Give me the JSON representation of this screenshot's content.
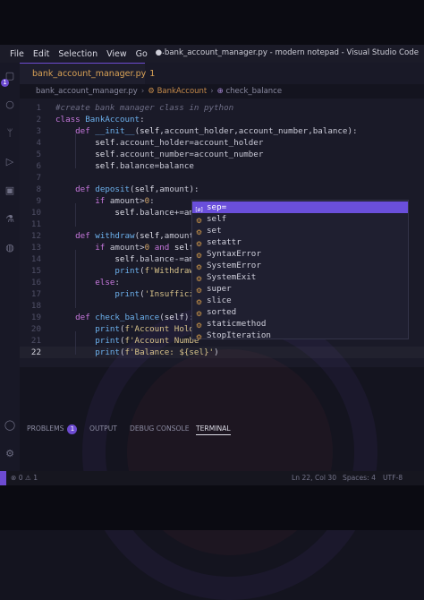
{
  "menu": [
    "File",
    "Edit",
    "Selection",
    "View",
    "Go",
    "···"
  ],
  "window_title": "● bank_account_manager.py - modern notepad - Visual Studio Code",
  "activity_badge": "1",
  "tab": {
    "filename": "bank_account_manager.py",
    "problems": "1"
  },
  "breadcrumb": {
    "file": "bank_account_manager.py",
    "class": "BankAccount",
    "method": "check_balance"
  },
  "code_lines": [
    {
      "n": "1",
      "html": "<span class='cmt'>#create bank manager class in python</span>"
    },
    {
      "n": "2",
      "html": "<span class='kw'>class</span> <span class='fnc'>BankAccount</span>:"
    },
    {
      "n": "3",
      "html": "    <span class='kw'>def</span> <span class='fnc'>__init__</span>(<span class='self'>self</span>,account_holder,account_number,balance):"
    },
    {
      "n": "4",
      "html": "        <span class='self'>self</span>.account_holder=account_holder"
    },
    {
      "n": "5",
      "html": "        <span class='self'>self</span>.account_number=account_number"
    },
    {
      "n": "6",
      "html": "        <span class='self'>self</span>.balance=balance"
    },
    {
      "n": "7",
      "html": ""
    },
    {
      "n": "8",
      "html": "    <span class='kw'>def</span> <span class='fnc'>deposit</span>(<span class='self'>self</span>,amount):"
    },
    {
      "n": "9",
      "html": "        <span class='kw'>if</span> amount><span class='num'>0</span>:"
    },
    {
      "n": "10",
      "html": "            <span class='self'>self</span>.balance+=amo"
    },
    {
      "n": "11",
      "html": ""
    },
    {
      "n": "12",
      "html": "    <span class='kw'>def</span> <span class='fnc'>withdraw</span>(<span class='self'>self</span>,amount):"
    },
    {
      "n": "13",
      "html": "        <span class='kw'>if</span> amount><span class='num'>0</span> <span class='kw'>and</span> <span class='self'>self</span>."
    },
    {
      "n": "14",
      "html": "            <span class='self'>self</span>.balance-=amo"
    },
    {
      "n": "15",
      "html": "            <span class='fnc'>print</span>(<span class='str'>f'Withdraw</span>"
    },
    {
      "n": "16",
      "html": "        <span class='kw'>else</span>:"
    },
    {
      "n": "17",
      "html": "            <span class='fnc'>print</span>(<span class='str'>'Insufficie</span>"
    },
    {
      "n": "18",
      "html": ""
    },
    {
      "n": "19",
      "html": "    <span class='kw'>def</span> <span class='fnc'>check_balance</span>(<span class='self'>self</span>):"
    },
    {
      "n": "20",
      "html": "        <span class='fnc'>print</span>(<span class='str'>f'Account Holde</span>"
    },
    {
      "n": "21",
      "html": "        <span class='fnc'>print</span>(<span class='str'>f'Account Numbe</span>"
    },
    {
      "n": "22",
      "html": "        <span class='fnc'>print</span>(<span class='str'>f'Balance: ${sel}'</span>)"
    }
  ],
  "suggestions": [
    "sep=",
    "self",
    "set",
    "setattr",
    "SyntaxError",
    "SystemError",
    "SystemExit",
    "super",
    "slice",
    "sorted",
    "staticmethod",
    "StopIteration"
  ],
  "panel_tabs": {
    "problems": "PROBLEMS",
    "problems_count": "1",
    "output": "OUTPUT",
    "debug": "DEBUG CONSOLE",
    "terminal": "TERMINAL"
  },
  "status": {
    "errors": "⊗ 0 ⚠ 1",
    "position": "Ln 22, Col 30",
    "spaces": "Spaces: 4",
    "encoding": "UTF-8"
  },
  "colors": {
    "accent": "#6d4bd1",
    "tab_text": "#d9a256",
    "keyword": "#c778dd",
    "function": "#6cb0ec",
    "string": "#d7c28a"
  }
}
